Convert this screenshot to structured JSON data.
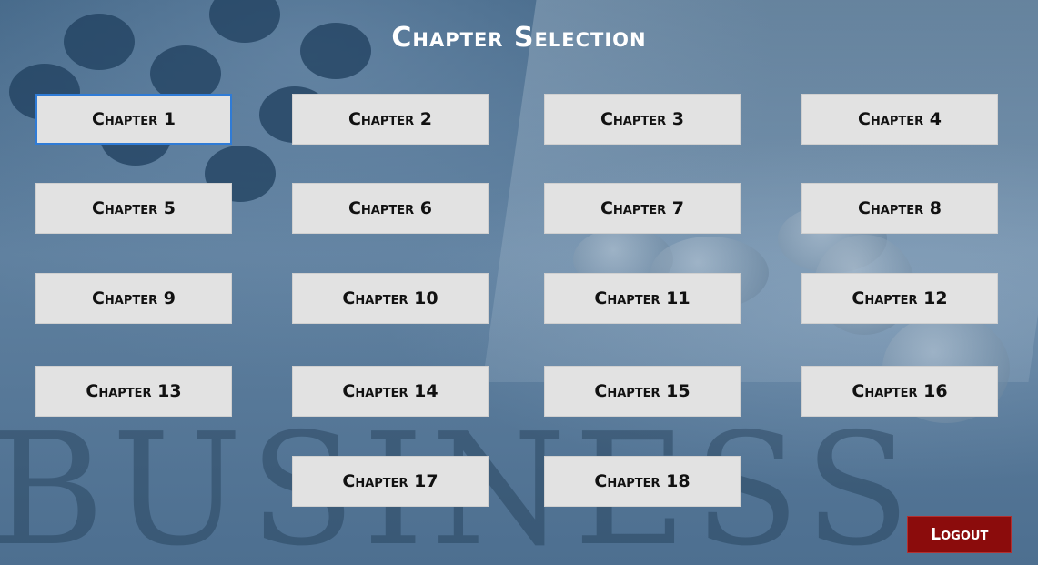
{
  "header": {
    "title": "Chapter Selection"
  },
  "chapters": [
    {
      "label": "Chapter 1"
    },
    {
      "label": "Chapter 2"
    },
    {
      "label": "Chapter 3"
    },
    {
      "label": "Chapter 4"
    },
    {
      "label": "Chapter 5"
    },
    {
      "label": "Chapter 6"
    },
    {
      "label": "Chapter 7"
    },
    {
      "label": "Chapter 8"
    },
    {
      "label": "Chapter 9"
    },
    {
      "label": "Chapter 10"
    },
    {
      "label": "Chapter 11"
    },
    {
      "label": "Chapter 12"
    },
    {
      "label": "Chapter 13"
    },
    {
      "label": "Chapter 14"
    },
    {
      "label": "Chapter 15"
    },
    {
      "label": "Chapter 16"
    },
    {
      "label": "Chapter 17"
    },
    {
      "label": "Chapter 18"
    }
  ],
  "focused_chapter": "Chapter 1",
  "logout": {
    "label": "Logout"
  },
  "colors": {
    "focus_border": "#2f7bd6",
    "button_bg": "#e2e2e2",
    "logout_bg": "#8b0c0c",
    "title_text": "#ffffff"
  }
}
